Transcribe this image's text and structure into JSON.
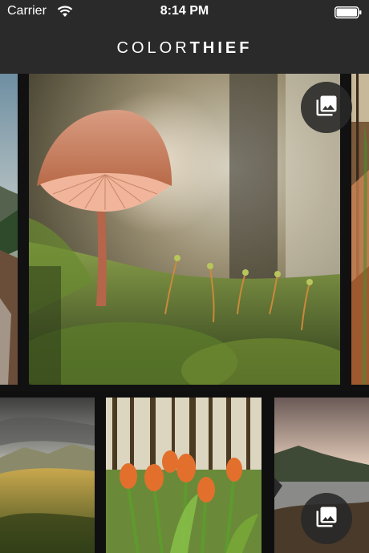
{
  "status_bar": {
    "carrier": "Carrier",
    "time": "8:14 PM",
    "wifi_icon": "wifi-icon",
    "battery_icon": "battery-icon"
  },
  "nav_bar": {
    "title_light": "COLOR",
    "title_bold": "THIEF"
  },
  "carousel": {
    "photos": [
      {
        "name": "coastal-cliffs-photo"
      },
      {
        "name": "mushroom-photo"
      },
      {
        "name": "autumn-forest-photo"
      }
    ],
    "gallery_icon": "photo-library-icon"
  },
  "thumbnails": {
    "photos": [
      {
        "name": "storm-mountain-valley-photo"
      },
      {
        "name": "orange-tulips-forest-photo"
      },
      {
        "name": "mountain-lake-photo"
      }
    ],
    "gallery_icon": "photo-library-icon"
  },
  "colors": {
    "bar_background": "#2a2a2a",
    "button_background": "#282828"
  }
}
